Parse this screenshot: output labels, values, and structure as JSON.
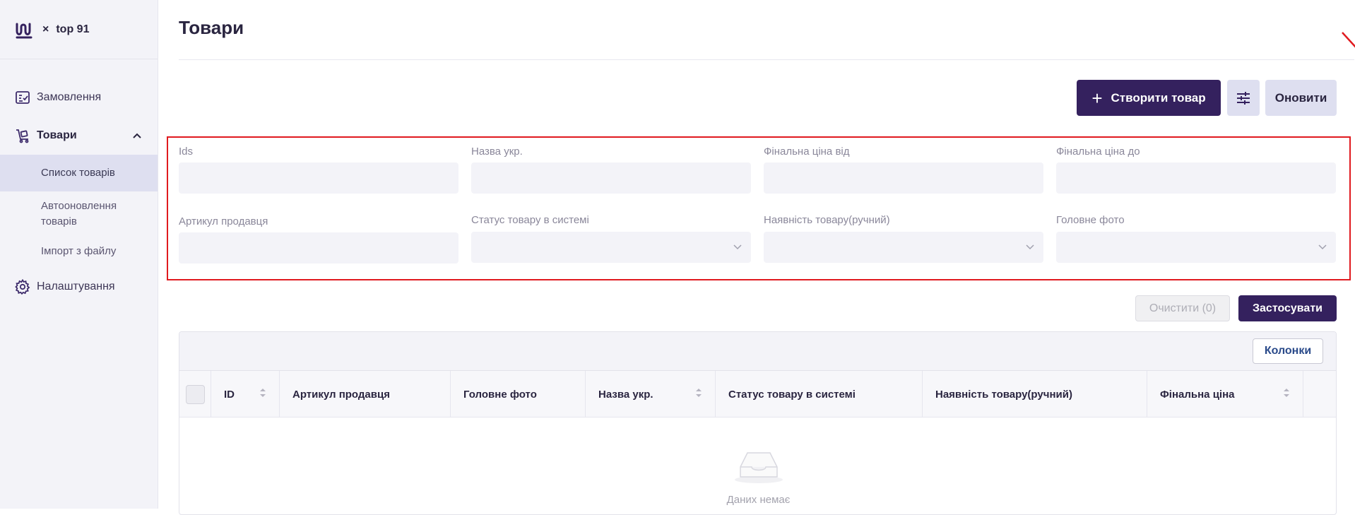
{
  "brand": {
    "close_glyph": "×",
    "shop_name": "top 91",
    "logo_icon": "brand-logo-icon"
  },
  "sidebar": {
    "items": [
      {
        "label": "Замовлення",
        "icon": "orders-icon"
      },
      {
        "label": "Товари",
        "icon": "products-icon",
        "expanded": true
      },
      {
        "label": "Налаштування",
        "icon": "settings-icon"
      }
    ],
    "sub_items": [
      {
        "label": "Список товарів",
        "active": true
      },
      {
        "label": "Автооновлення товарів"
      },
      {
        "label": "Імпорт з файлу"
      }
    ]
  },
  "page": {
    "title": "Товари"
  },
  "toolbar": {
    "create_label": "Створити товар",
    "create_plus": "+",
    "refresh_label": "Оновити",
    "filter_icon": "filter-sliders-icon"
  },
  "filters": [
    {
      "label": "Ids",
      "value": "",
      "type": "text"
    },
    {
      "label": "Назва укр.",
      "value": "",
      "type": "text"
    },
    {
      "label": "Фінальна ціна від",
      "value": "",
      "type": "text"
    },
    {
      "label": "Фінальна ціна до",
      "value": "",
      "type": "text"
    },
    {
      "label": "Артикул продавця",
      "value": "",
      "type": "text"
    },
    {
      "label": "Статус товару в системі",
      "value": "",
      "type": "select"
    },
    {
      "label": "Наявність товару(ручний)",
      "value": "",
      "type": "select"
    },
    {
      "label": "Головне фото",
      "value": "",
      "type": "select"
    }
  ],
  "filter_actions": {
    "clear_label": "Очистити (0)",
    "apply_label": "Застосувати"
  },
  "table": {
    "columns_button": "Колонки",
    "headers": [
      "ID",
      "Артикул продавця",
      "Головне фото",
      "Назва укр.",
      "Статус товару в системі",
      "Наявність товару(ручний)",
      "Фінальна ціна"
    ],
    "sortable": [
      true,
      false,
      false,
      true,
      false,
      false,
      true
    ],
    "empty_text": "Даних немає"
  },
  "colors": {
    "primary": "#34215e",
    "secondary": "#dedff0",
    "highlight": "#e01a1f",
    "sidebar_bg": "#f3f3f8"
  }
}
